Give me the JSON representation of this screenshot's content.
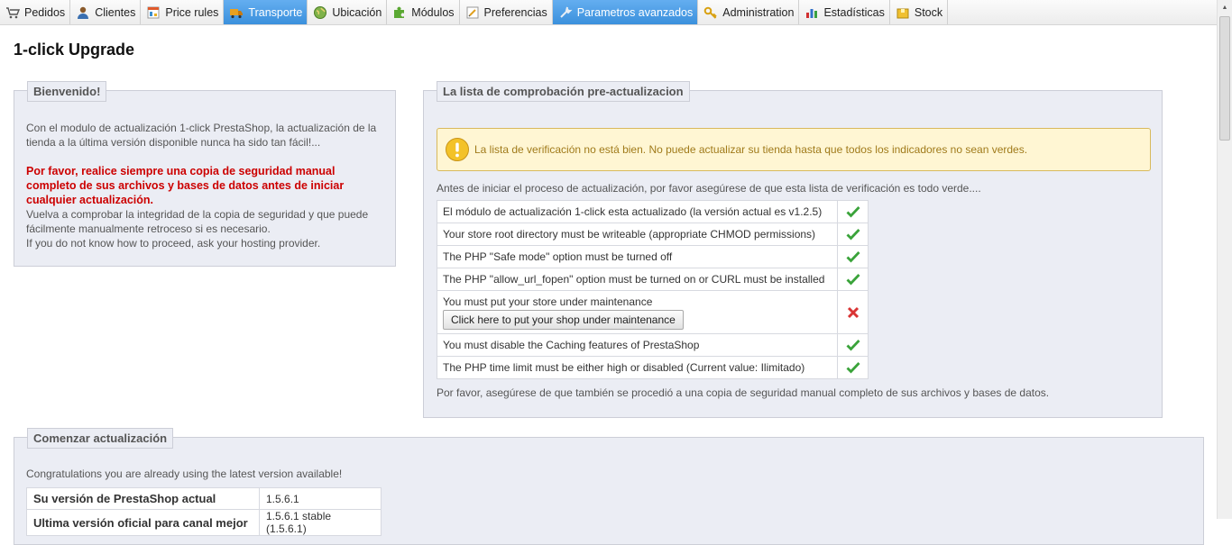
{
  "menu": {
    "items": [
      {
        "label": "Pedidos",
        "icon": "cart-icon",
        "active": false
      },
      {
        "label": "Clientes",
        "icon": "user-icon",
        "active": false
      },
      {
        "label": "Price rules",
        "icon": "price-tag-icon",
        "active": false
      },
      {
        "label": "Transporte",
        "icon": "truck-icon",
        "active": true
      },
      {
        "label": "Ubicación",
        "icon": "globe-icon",
        "active": false
      },
      {
        "label": "Módulos",
        "icon": "puzzle-icon",
        "active": false
      },
      {
        "label": "Preferencias",
        "icon": "preferences-icon",
        "active": false
      },
      {
        "label": "Parametros avanzados",
        "icon": "wrench-icon",
        "active": true
      },
      {
        "label": "Administration",
        "icon": "key-icon",
        "active": false
      },
      {
        "label": "Estadísticas",
        "icon": "bar-chart-icon",
        "active": false
      },
      {
        "label": "Stock",
        "icon": "stock-box-icon",
        "active": false
      }
    ]
  },
  "page": {
    "title": "1-click Upgrade"
  },
  "welcome": {
    "legend": "Bienvenido!",
    "intro": "Con el modulo de actualización 1-click PrestaShop, la actualización de la tienda a la última versión disponible nunca ha sido tan fácil!...",
    "warning": "Por favor, realice siempre una copia de seguridad manual completo de sus archivos y bases de datos antes de iniciar cualquier actualización.",
    "check_backup": "Vuelva a comprobar la integridad de la copia de seguridad y que puede fácilmente manualmente retroceso si es necesario.",
    "hosting": "If you do not know how to proceed, ask your hosting provider."
  },
  "checklist": {
    "legend": "La lista de comprobación pre-actualizacion",
    "alert": "La lista de verificación no está bien. No puede actualizar su tienda hasta que todos los indicadores no sean verdes.",
    "intro": "Antes de iniciar el proceso de actualización, por favor asegúrese de que esta lista de verificación es todo verde....",
    "items": [
      {
        "text": "El módulo de actualización 1-click esta actualizado (la versión actual es v1.2.5)",
        "ok": true
      },
      {
        "text": "Your store root directory must be writeable (appropriate CHMOD permissions)",
        "ok": true
      },
      {
        "text": "The PHP \"Safe mode\" option must be turned off",
        "ok": true
      },
      {
        "text": "The PHP \"allow_url_fopen\" option must be turned on or CURL must be installed",
        "ok": true
      },
      {
        "text": "You must put your store under maintenance",
        "ok": false,
        "button": "Click here to put your shop under maintenance"
      },
      {
        "text": "You must disable the Caching features of PrestaShop",
        "ok": true
      },
      {
        "text": "The PHP time limit must be either high or disabled (Current value: Ilimitado)",
        "ok": true
      }
    ],
    "outro": "Por favor, asegúrese de que también se procedió a una copia de seguridad manual completo de sus archivos y bases de datos."
  },
  "upgrade": {
    "legend": "Comenzar actualización",
    "congrats": "Congratulations you are already using the latest version available!",
    "rows": [
      {
        "label": "Su versión de PrestaShop actual",
        "value": "1.5.6.1"
      },
      {
        "label": "Ultima versión oficial para canal mejor",
        "value": "1.5.6.1 stable (1.5.6.1)"
      }
    ]
  },
  "colors": {
    "active_tab": "#3b90dc",
    "ok": "#3aa33a",
    "fail": "#d93434",
    "warning_text": "#cc0000"
  }
}
